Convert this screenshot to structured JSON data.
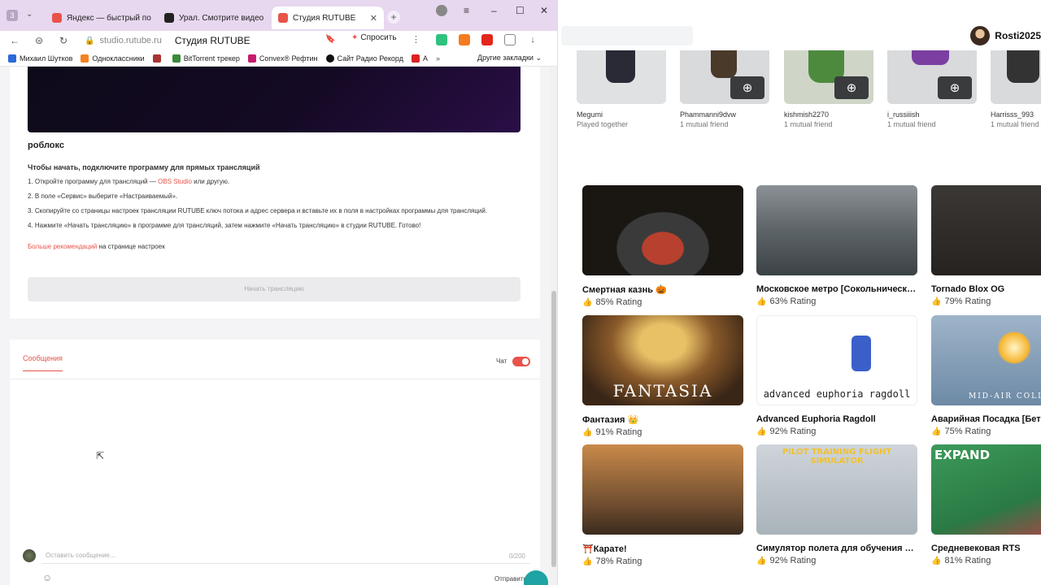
{
  "browser": {
    "tab_count": "3",
    "tabs": [
      {
        "label": "Яндекс — быстрый поиск",
        "color": "#e8534a"
      },
      {
        "label": "Урал. Смотрите видео онлайн",
        "color": "#222222"
      },
      {
        "label": "Студия RUTUBE",
        "color": "#e8534a"
      }
    ],
    "address": {
      "domain": "studio.rutube.ru",
      "title": "Студия RUTUBE"
    },
    "ask_label": "Спросить",
    "bookmarks": [
      "Михаил Шутков",
      "Одноклассники",
      "",
      "BitTorrent трекер",
      "Convex® Рефтин",
      "Сайт Радио Рекорд",
      "А"
    ],
    "other_bookmarks": "Другие закладки"
  },
  "studio": {
    "stream_title": "роблокс",
    "instructions_head": "Чтобы начать, подключите программу для прямых трансляций",
    "step1_prefix": "1. Откройте программу для трансляций —",
    "step1_link": "OBS Studio",
    "step1_suffix": "или другую.",
    "step2": "2. В поле «Сервис» выберите «Настраиваемый».",
    "step3": "3. Скопируйте со страницы настроек трансляции RUTUBE ключ потока и адрес сервера и вставьте их в поля в настройках программы для трансляций.",
    "step4": "4. Нажмите «Начать трансляцию» в программе для трансляций, затем нажмите «Начать трансляцию» в студии RUTUBE. Готово!",
    "more_link": "Больше рекомендаций",
    "more_suffix": "на странице настроек",
    "start_button": "Начать трансляцию",
    "messages_tab": "Сообщения",
    "chat_label": "Чат",
    "chat_placeholder": "Оставить сообщение...",
    "chat_count": "0/200",
    "send_label": "Отправить"
  },
  "roblox": {
    "username": "Rosti2025",
    "friends": [
      {
        "name": "Megumi",
        "sub": "Played together"
      },
      {
        "name": "Phammanni9dvw",
        "sub": "1 mutual friend"
      },
      {
        "name": "kishmish2270",
        "sub": "1 mutual friend"
      },
      {
        "name": "i_russiiish",
        "sub": "1 mutual friend"
      },
      {
        "name": "Harrisss_993",
        "sub": "1 mutual friend"
      }
    ],
    "games": [
      {
        "title": "Смертная казнь 🎃",
        "rating": "85% Rating",
        "caption": ""
      },
      {
        "title": "Московское метро [Сокольническая линия]",
        "rating": "63% Rating",
        "caption": ""
      },
      {
        "title": "Tornado Blox OG",
        "rating": "79% Rating",
        "caption": ""
      },
      {
        "title": "Фантазия 👑",
        "rating": "91% Rating",
        "caption": "FANTASIA"
      },
      {
        "title": "Advanced Euphoria Ragdoll",
        "rating": "92% Rating",
        "caption": "advanced euphoria ragdoll"
      },
      {
        "title": "Аварийная Посадка [Бета]",
        "rating": "75% Rating",
        "caption": "MID-AIR COLLISION"
      },
      {
        "title": "⛩️Карате!",
        "rating": "78% Rating",
        "caption": ""
      },
      {
        "title": "Симулятор полета для обучения пилотов",
        "rating": "92% Rating",
        "caption": "PILOT TRAINING FLIGHT SIMULATOR"
      },
      {
        "title": "Средневековая RTS",
        "rating": "81% Rating",
        "caption": "EXPAND"
      }
    ]
  }
}
